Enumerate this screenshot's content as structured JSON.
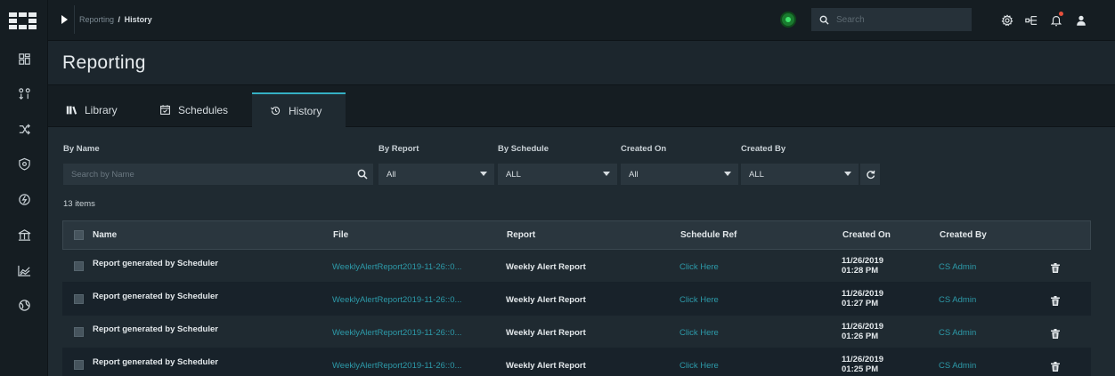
{
  "rail": {
    "icons": [
      "dashboard-icon",
      "sort-icon",
      "shuffle-icon",
      "shield-icon",
      "lightning-icon",
      "columns-icon",
      "chart-icon",
      "globe-icon"
    ]
  },
  "topbar": {
    "breadcrumb": {
      "parent": "Reporting",
      "separator": "/",
      "current": "History"
    },
    "search_placeholder": "Search",
    "status_color": "#3ee26a",
    "accent_color": "#35b0c4"
  },
  "page": {
    "title": "Reporting"
  },
  "tabs": [
    {
      "label": "Library",
      "icon": "library-icon"
    },
    {
      "label": "Schedules",
      "icon": "calendar-icon"
    },
    {
      "label": "History",
      "icon": "history-icon",
      "active": true
    }
  ],
  "filters": {
    "by_name_label": "By Name",
    "by_name_placeholder": "Search by Name",
    "by_report_label": "By Report",
    "by_report_value": "All",
    "by_schedule_label": "By Schedule",
    "by_schedule_value": "ALL",
    "created_on_label": "Created On",
    "created_on_value": "All",
    "created_by_label": "Created By",
    "created_by_value": "ALL"
  },
  "item_count": "13 items",
  "table": {
    "columns": [
      "Name",
      "File",
      "Report",
      "Schedule Ref",
      "Created On",
      "Created By"
    ],
    "rows": [
      {
        "name": "Report generated by Scheduler",
        "file": "WeeklyAlertReport2019-11-26::0...",
        "report": "Weekly Alert Report",
        "schedule_ref": "Click Here",
        "created_date": "11/26/2019",
        "created_time": "01:28 PM",
        "created_by": "CS Admin"
      },
      {
        "name": "Report generated by Scheduler",
        "file": "WeeklyAlertReport2019-11-26::0...",
        "report": "Weekly Alert Report",
        "schedule_ref": "Click Here",
        "created_date": "11/26/2019",
        "created_time": "01:27 PM",
        "created_by": "CS Admin"
      },
      {
        "name": "Report generated by Scheduler",
        "file": "WeeklyAlertReport2019-11-26::0...",
        "report": "Weekly Alert Report",
        "schedule_ref": "Click Here",
        "created_date": "11/26/2019",
        "created_time": "01:26 PM",
        "created_by": "CS Admin"
      },
      {
        "name": "Report generated by Scheduler",
        "file": "WeeklyAlertReport2019-11-26::0...",
        "report": "Weekly Alert Report",
        "schedule_ref": "Click Here",
        "created_date": "11/26/2019",
        "created_time": "01:25 PM",
        "created_by": "CS Admin"
      }
    ]
  }
}
